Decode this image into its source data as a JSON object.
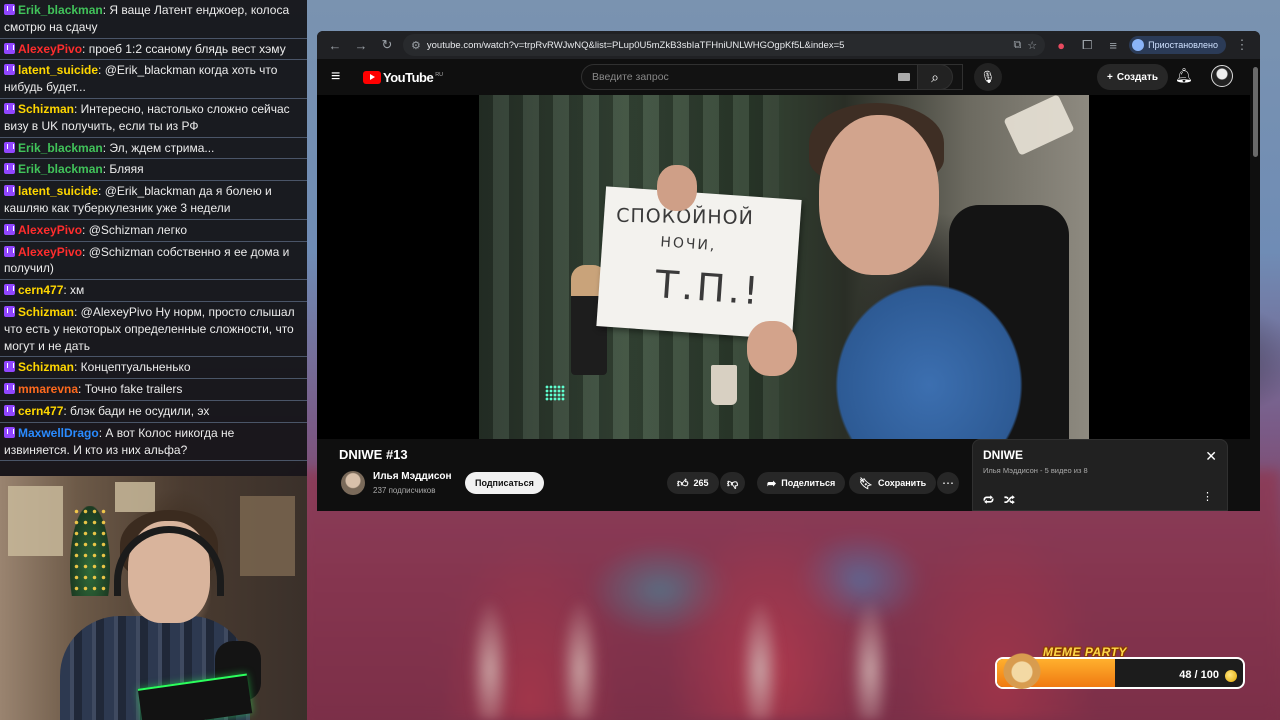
{
  "chat": {
    "messages": [
      {
        "user": "Erik_blackman",
        "color": "green",
        "text": ": Я ваще Латент енджоер, колоса смотрю на сдачу"
      },
      {
        "user": "AlexeyPivo",
        "color": "red",
        "text": ": проеб 1:2 ссаному блядь вест хэму"
      },
      {
        "user": "latent_suicide",
        "color": "yellow",
        "text": ": @Erik_blackman когда хоть что нибудь будет..."
      },
      {
        "user": "Schizman",
        "color": "yellow",
        "text": ": Интересно, настолько сложно сейчас визу в UK получить, если ты из РФ"
      },
      {
        "user": "Erik_blackman",
        "color": "green",
        "text": ": Эл, ждем стрима..."
      },
      {
        "user": "Erik_blackman",
        "color": "green",
        "text": ": Бляяя"
      },
      {
        "user": "latent_suicide",
        "color": "yellow",
        "text": ": @Erik_blackman да я болею и кашляю как туберкулезник уже 3 недели"
      },
      {
        "user": "AlexeyPivo",
        "color": "red",
        "text": ": @Schizman легко"
      },
      {
        "user": "AlexeyPivo",
        "color": "red",
        "text": ": @Schizman собственно я ее дома и получил)"
      },
      {
        "user": "cern477",
        "color": "yellow",
        "text": ": хм"
      },
      {
        "user": "Schizman",
        "color": "yellow",
        "text": ": @AlexeyPivo Ну норм, просто слышал что есть у некоторых определенные сложности, что могут и не дать"
      },
      {
        "user": "Schizman",
        "color": "yellow",
        "text": ": Концептуальненько"
      },
      {
        "user": "mmarevna",
        "color": "orange",
        "text": ": Точно fake trailers"
      },
      {
        "user": "cern477",
        "color": "yellow",
        "text": ": блэк бади не осудили, эх"
      },
      {
        "user": "MaxwellDrago",
        "color": "blue",
        "text": ": А вот Колос никогда не извиняется. И кто из них альфа?"
      }
    ]
  },
  "browser": {
    "url": "youtube.com/watch?v=trpRvRWJwNQ&list=PLup0U5mZkB3sbIaTFHniUNLWHGOgpKf5L&index=5",
    "profile_label": "Приостановлено"
  },
  "youtube": {
    "logo_text": "YouTube",
    "region": "RU",
    "search_placeholder": "Введите запрос",
    "create_label": "Создать",
    "video_title": "DNIWE #13",
    "channel_name": "Илья Мэддисон",
    "channel_subs": "237 подписчиков",
    "subscribe_label": "Подписаться",
    "like_count": "265",
    "share_label": "Поделиться",
    "save_label": "Сохранить",
    "sign_line1": "СПОКОЙНОЙ",
    "sign_line2": "НОЧИ,",
    "sign_line3": "Т.П.!",
    "playlist": {
      "title": "DNIWE",
      "meta": "Илья Мэддисон - 5 видео из 8"
    }
  },
  "meme_party": {
    "title": "MEME PARTY",
    "count": "48 / 100",
    "progress": 0.48
  },
  "icons": {
    "back": "back-arrow-icon",
    "forward": "forward-arrow-icon",
    "reload": "reload-icon",
    "menu": "hamburger-menu-icon",
    "search": "search-icon",
    "mic": "mic-icon",
    "bell": "bell-icon",
    "like": "thumbs-up-icon",
    "dislike": "thumbs-down-icon",
    "share": "share-icon",
    "save": "bookmark-icon",
    "close": "close-icon",
    "loop": "loop-icon",
    "shuffle": "shuffle-icon"
  },
  "colors": {
    "twitch_badge": "#9146ff",
    "youtube_red": "#ff0000",
    "meme_fill": "#f07a12"
  }
}
